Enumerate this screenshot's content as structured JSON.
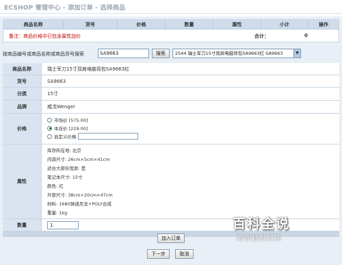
{
  "window": {
    "title": "ECSHOP 管理中心 - 添加订单 - 选择商品"
  },
  "cart": {
    "columns": [
      "商品名称",
      "货号",
      "价格",
      "数量",
      "属性",
      "小计",
      "操作"
    ],
    "note": "备注：商品价格中已包含属性加价",
    "total_label": "合计：",
    "total_value": "0"
  },
  "search": {
    "label": "按商品编号或商品名称或商品货号搜索",
    "value": "SA9663",
    "button": "搜索",
    "selected_option": "2544 瑞士军刀15寸双肩电脑背包SA9663红 SA9663"
  },
  "detail": {
    "name_label": "商品名称",
    "name_value": "瑞士军刀15寸双肩电脑背包SA9663红",
    "sn_label": "货号",
    "sn_value": "SA9663",
    "category_label": "分类",
    "category_value": "15寸",
    "brand_label": "品牌",
    "brand_value": "威戈Wenger",
    "price_label": "价格",
    "price_options": [
      "市场价 [575.00]",
      "本店价 [229.00]",
      "自定义价格"
    ],
    "price_selected": 1,
    "attr_label": "属性",
    "attributes": [
      "库存所在地: 北京",
      "内袋尺寸: 26cm×5cm×41cm",
      "适合大部份宽屏: 是",
      "笔记本尺寸: 15寸",
      "颜色: 红",
      "外部尺寸: 38cm×20cm×47cm",
      "材料: 1680弹道尼龙+POLY合成",
      "重量: 1kg"
    ],
    "qty_label": "数量",
    "qty_value": "1"
  },
  "buttons": {
    "add_to_order": "加入订单",
    "next": "下一步",
    "cancel": "取消"
  },
  "watermark": {
    "main": "百科全说",
    "sub": "助你轻松解决"
  }
}
